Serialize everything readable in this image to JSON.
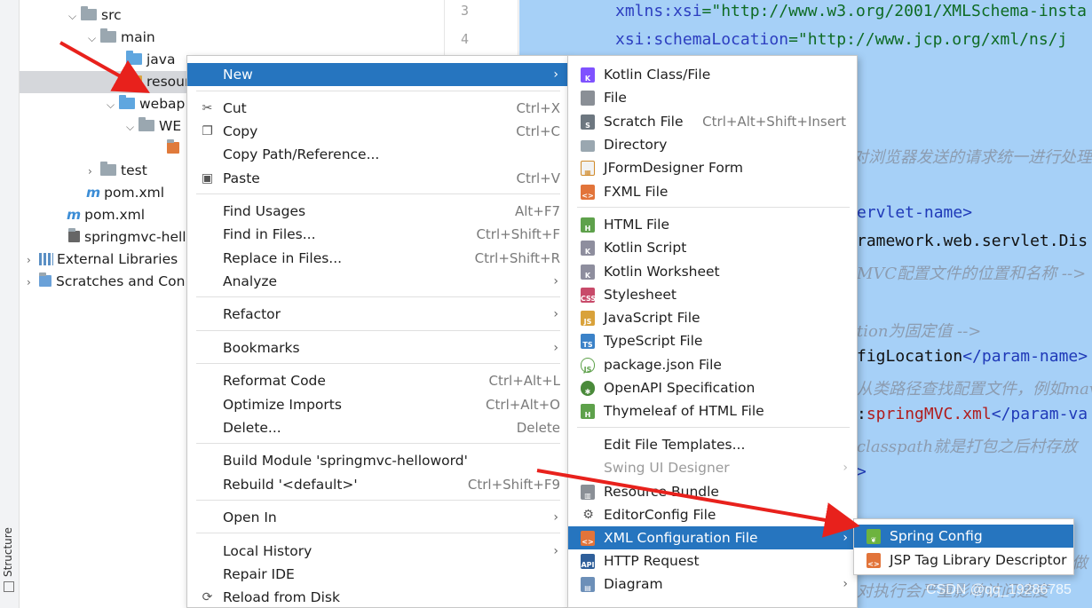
{
  "structure_tab": {
    "label": "Structure"
  },
  "tree": {
    "items": [
      {
        "label": "src"
      },
      {
        "label": "main"
      },
      {
        "label": "java"
      },
      {
        "label": "resour"
      },
      {
        "label": "webap"
      },
      {
        "label": "WE"
      },
      {
        "label": "test"
      },
      {
        "label": "pom.xml"
      },
      {
        "label": "pom.xml"
      },
      {
        "label": "springmvc-hello"
      },
      {
        "label": "External Libraries"
      },
      {
        "label": "Scratches and Con"
      }
    ]
  },
  "gutter": {
    "lines": [
      "3",
      "4"
    ]
  },
  "editor": {
    "lines": [
      {
        "a": "xmlns:xsi",
        "b": "=\"http://www.w3.org/2001/XMLSchema-insta"
      },
      {
        "a": "xsi:schemaLocation",
        "b": "=\"http://www.jcp.org/xml/ns/j"
      },
      {
        "c": "对浏览器发送的请求统一进行处理"
      },
      {
        "t": "ervlet-name>"
      },
      {
        "t": "ramework.web.servlet.Dis"
      },
      {
        "c": "MVC配置文件的位置和名称 -->"
      },
      {
        "c": "tion为固定值 -->"
      },
      {
        "k": "figLocation",
        "t": "</param-name>"
      },
      {
        "c": "从类路径查找配置文件，例如mav"
      },
      {
        "k": ":",
        "r": "springMVC.xml",
        "t": "</param-va"
      },
      {
        "c": "classpath就是打包之后村存放"
      },
      {
        "t": ">"
      },
      {
        "c": "做"
      },
      {
        "c": "对执行会严重影响访问速度"
      }
    ],
    "watermark": "CSDN @qq_19286785"
  },
  "context_menu": {
    "items": [
      {
        "label": "New",
        "shortcut": "",
        "submenu": true
      },
      {
        "label": "Cut",
        "shortcut": "Ctrl+X",
        "icon": "scissors-icon"
      },
      {
        "label": "Copy",
        "shortcut": "Ctrl+C",
        "icon": "copy-icon"
      },
      {
        "label": "Copy Path/Reference...",
        "shortcut": ""
      },
      {
        "label": "Paste",
        "shortcut": "Ctrl+V",
        "icon": "paste-icon"
      },
      {
        "label": "Find Usages",
        "shortcut": "Alt+F7"
      },
      {
        "label": "Find in Files...",
        "shortcut": "Ctrl+Shift+F"
      },
      {
        "label": "Replace in Files...",
        "shortcut": "Ctrl+Shift+R"
      },
      {
        "label": "Analyze",
        "shortcut": "",
        "submenu": true
      },
      {
        "label": "Refactor",
        "shortcut": "",
        "submenu": true
      },
      {
        "label": "Bookmarks",
        "shortcut": "",
        "submenu": true
      },
      {
        "label": "Reformat Code",
        "shortcut": "Ctrl+Alt+L"
      },
      {
        "label": "Optimize Imports",
        "shortcut": "Ctrl+Alt+O"
      },
      {
        "label": "Delete...",
        "shortcut": "Delete"
      },
      {
        "label": "Build Module 'springmvc-helloword'",
        "shortcut": ""
      },
      {
        "label": "Rebuild '<default>'",
        "shortcut": "Ctrl+Shift+F9"
      },
      {
        "label": "Open In",
        "shortcut": "",
        "submenu": true
      },
      {
        "label": "Local History",
        "shortcut": "",
        "submenu": true
      },
      {
        "label": "Repair IDE",
        "shortcut": ""
      },
      {
        "label": "Reload from Disk",
        "shortcut": "",
        "icon": "reload-icon"
      }
    ]
  },
  "new_menu": {
    "items": [
      {
        "label": "Kotlin Class/File",
        "shortcut": ""
      },
      {
        "label": "File",
        "shortcut": ""
      },
      {
        "label": "Scratch File",
        "shortcut": "Ctrl+Alt+Shift+Insert"
      },
      {
        "label": "Directory",
        "shortcut": ""
      },
      {
        "label": "JFormDesigner Form",
        "shortcut": ""
      },
      {
        "label": "FXML File",
        "shortcut": ""
      },
      {
        "label": "HTML File",
        "shortcut": ""
      },
      {
        "label": "Kotlin Script",
        "shortcut": ""
      },
      {
        "label": "Kotlin Worksheet",
        "shortcut": ""
      },
      {
        "label": "Stylesheet",
        "shortcut": ""
      },
      {
        "label": "JavaScript File",
        "shortcut": ""
      },
      {
        "label": "TypeScript File",
        "shortcut": ""
      },
      {
        "label": "package.json File",
        "shortcut": ""
      },
      {
        "label": "OpenAPI Specification",
        "shortcut": ""
      },
      {
        "label": "Thymeleaf of HTML File",
        "shortcut": ""
      },
      {
        "label": "Edit File Templates...",
        "shortcut": ""
      },
      {
        "label": "Swing UI Designer",
        "shortcut": ""
      },
      {
        "label": "Resource Bundle",
        "shortcut": ""
      },
      {
        "label": "EditorConfig File",
        "shortcut": ""
      },
      {
        "label": "XML Configuration File",
        "shortcut": ""
      },
      {
        "label": "HTTP Request",
        "shortcut": ""
      },
      {
        "label": "Diagram",
        "shortcut": ""
      }
    ]
  },
  "xml_menu": {
    "items": [
      {
        "label": "Spring Config"
      },
      {
        "label": "JSP Tag Library Descriptor"
      }
    ]
  },
  "colors": {
    "highlight": "#2675bf",
    "editor_bg": "#a6d0f7",
    "arrow": "#e8211c"
  }
}
